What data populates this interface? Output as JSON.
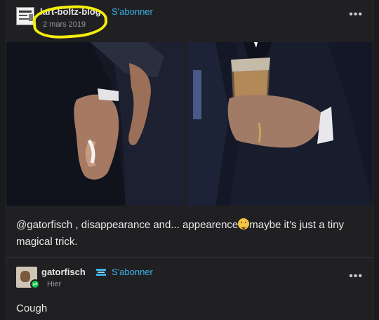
{
  "post": {
    "blog_name": "lart-boltz-blog",
    "follow_label": "S'abonner",
    "date": "2 mars 2019",
    "more_label": "•••",
    "caption": {
      "mention": "@gatorfisch",
      "text_before_emoji": " , disappearance and... appearence",
      "text_after_emoji": "maybe it’s just a tiny magical trick."
    },
    "emoji_icon": "thinking-face-icon",
    "highlight_color": "#f5ee0a"
  },
  "reply": {
    "name": "gatorfisch",
    "follow_label": "S'abonner",
    "time": "Hier",
    "more_label": "•••",
    "text": "Cough",
    "badge_icon": "reblog-badge-icon"
  },
  "colors": {
    "accent": "#3ab1e6",
    "background": "#202023"
  }
}
